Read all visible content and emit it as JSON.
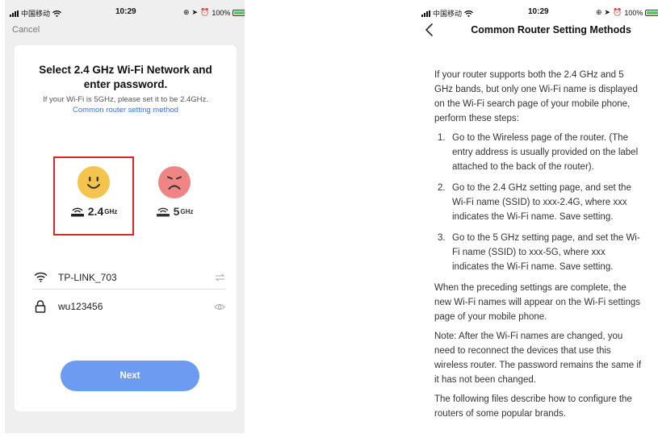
{
  "left_status": {
    "carrier": "中国移动",
    "time": "10:29",
    "battery": "100%"
  },
  "right_status": {
    "carrier": "中国移动",
    "time": "10:29",
    "battery": "100%"
  },
  "setup": {
    "cancel_label": "Cancel",
    "title": "Select 2.4 GHz Wi-Fi Network and enter password.",
    "subtitle": "If your Wi-Fi is 5GHz, please set it to be 2.4GHz.",
    "link_text": "Common router setting method",
    "bands": [
      {
        "number": "2.4",
        "unit": "GHz",
        "state": "good",
        "selected": true
      },
      {
        "number": "5",
        "unit": "GHz",
        "state": "bad",
        "selected": false
      }
    ],
    "ssid_value": "TP-LINK_703",
    "password_value": "wu123456",
    "next_label": "Next"
  },
  "help": {
    "title": "Common Router Setting Methods",
    "intro": "If your router supports both the 2.4 GHz and 5 GHz bands, but only one Wi-Fi name is displayed on the Wi-Fi search page of your mobile phone, perform these steps:",
    "steps": [
      {
        "num": "1.",
        "text": "Go to the Wireless page of the router. (The entry address is usually provided on the label attached to the back of the router)."
      },
      {
        "num": "2.",
        "text": "Go to the 2.4 GHz setting page, and set the Wi-Fi name (SSID) to xxx-2.4G, where xxx indicates the Wi-Fi name. Save setting."
      },
      {
        "num": "3.",
        "text": "Go to the 5 GHz setting page, and set the Wi-Fi name (SSID) to xxx-5G, where xxx indicates the Wi-Fi name. Save setting."
      }
    ],
    "after_steps": "When the preceding settings are complete, the new Wi-Fi names will appear on the Wi-Fi settings page of your mobile phone.",
    "note": "Note: After the Wi-Fi names are changed, you need to reconnect the devices that use this wireless router. The password remains the same if it has not been changed.",
    "footer": "The following files describe how to configure the routers of some popular brands."
  },
  "colors": {
    "accent": "#6e9bf2",
    "link": "#3a74d8",
    "highlight": "#d9262c",
    "good": "#f4c44d",
    "bad": "#f08585"
  }
}
